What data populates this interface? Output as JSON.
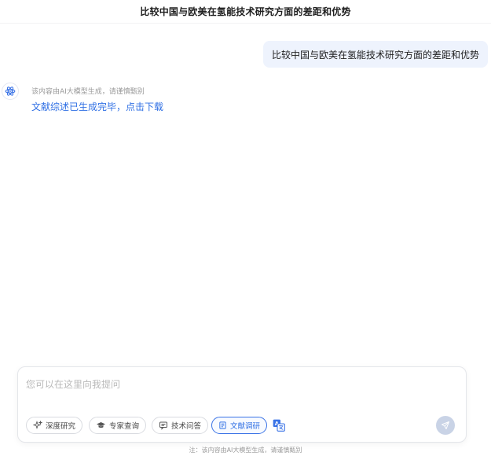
{
  "header": {
    "title": "比较中国与欧美在氢能技术研究方面的差距和优势"
  },
  "conversation": {
    "user_message": "比较中国与欧美在氢能技术研究方面的差距和优势",
    "bot": {
      "avatar_icon": "atom-icon",
      "note": "该内容由AI大模型生成，请谨慎甄别",
      "download_link": "文献综述已生成完毕，点击下载"
    }
  },
  "composer": {
    "placeholder": "您可以在这里向我提问",
    "modes": [
      {
        "label": "深度研究",
        "icon": "sparkle-icon",
        "active": false
      },
      {
        "label": "专家查询",
        "icon": "graduation-cap-icon",
        "active": false
      },
      {
        "label": "技术问答",
        "icon": "chat-bubble-icon",
        "active": false
      },
      {
        "label": "文献调研",
        "icon": "document-icon",
        "active": true
      }
    ],
    "translate_icon": "translate-icon",
    "send_icon": "send-icon"
  },
  "footer": {
    "note": "注：该内容由AI大模型生成，请谨慎甄别"
  },
  "colors": {
    "accent": "#2f6fe4",
    "bubble": "#eef3fd",
    "send_disabled": "#c9d3e6"
  }
}
